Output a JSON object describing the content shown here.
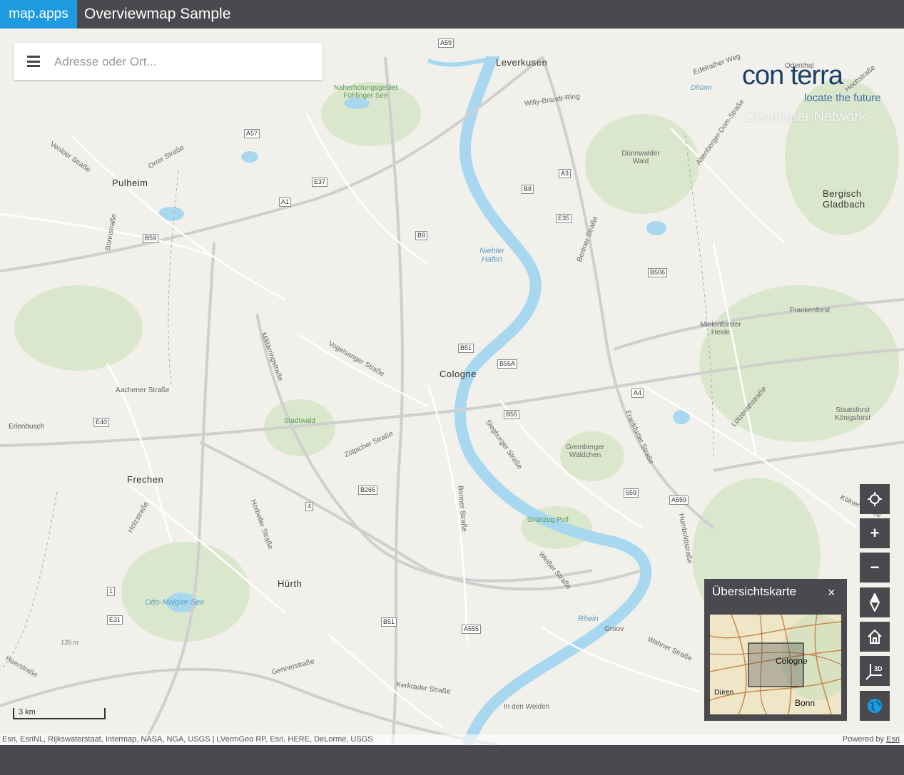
{
  "header": {
    "brand": "map.apps",
    "title": "Overviewmap Sample"
  },
  "search": {
    "placeholder": "Adresse oder Ort..."
  },
  "logo": {
    "name": "con terra",
    "tagline": "locate the future",
    "subtitle": "Developer Network"
  },
  "map": {
    "cities": [
      "Leverkusen",
      "Pulheim",
      "Cologne",
      "Frechen",
      "Hürth",
      "Bergisch Gladbach",
      "Erlenbusch"
    ],
    "districts": [
      "Dünnwalder Wald",
      "Mielenforster Heide",
      "Frankenforst",
      "Gremberger Wäldchen",
      "Staatsforst Königsforst",
      "Groov",
      "In den Weiden",
      "Odenthal"
    ],
    "streets": [
      "Willy-Brandt-Ring",
      "Venloer Straße",
      "Orrer Straße",
      "Militärringstraße",
      "Aachener Straße",
      "Vogelsanger Straße",
      "Zülpicher Straße",
      "Bonner Straße",
      "Siegburger Straße",
      "Frankfurter Straße",
      "Berliner Straße",
      "Kerkrader Straße",
      "Holzstraße",
      "Horbeller Straße",
      "Weißer Straße",
      "Wahner Straße",
      "Humboldtstraße",
      "Lützerathstraße",
      "Bonnstraße",
      "Gennerstraße",
      "Heerstraße",
      "Edelrather Weg",
      "Altenberger-Dom-Straße",
      "Kölner Straße",
      "Hochstraße"
    ],
    "water": [
      "Niehler Hafen",
      "Rhein",
      "Otto-Maigler-See",
      "Dhünn"
    ],
    "green": [
      "Naherholungsgebiet Fühlinger See",
      "Stadtwald",
      "Grünzug Poll"
    ],
    "shields": [
      "A1",
      "A3",
      "A4",
      "A57",
      "A59",
      "E37",
      "E35",
      "E40",
      "E31",
      "B9",
      "B8",
      "B51",
      "B55",
      "B55A",
      "B59",
      "B265",
      "B506",
      "B51",
      "A555",
      "A559",
      "559",
      "4",
      "1"
    ],
    "elevation": "135 m"
  },
  "scale": {
    "label": "3 km"
  },
  "attribution": {
    "text": "Esri, EsriNL, Rijkswaterstaat, Intermap, NASA, NGA, USGS | LVermGeo RP, Esri, HERE, DeLorme, USGS",
    "powered_prefix": "Powered by",
    "powered_link": "Esri"
  },
  "controls": {
    "locate_icon": "crosshair-icon",
    "zoom_in_label": "+",
    "zoom_out_label": "−",
    "compass_icon": "compass-icon",
    "home_icon": "home-icon",
    "view3d_label": "3D",
    "globe_icon": "globe-icon"
  },
  "overview": {
    "title": "Übersichtskarte",
    "close": "×",
    "labels": [
      "Cologne",
      "Düren",
      "Bonn"
    ]
  },
  "colors": {
    "header": "#4a4a4e",
    "brand": "#1e9be0",
    "water": "#a8d8f0",
    "green": "#d8e8c8",
    "road": "#ffffff"
  }
}
